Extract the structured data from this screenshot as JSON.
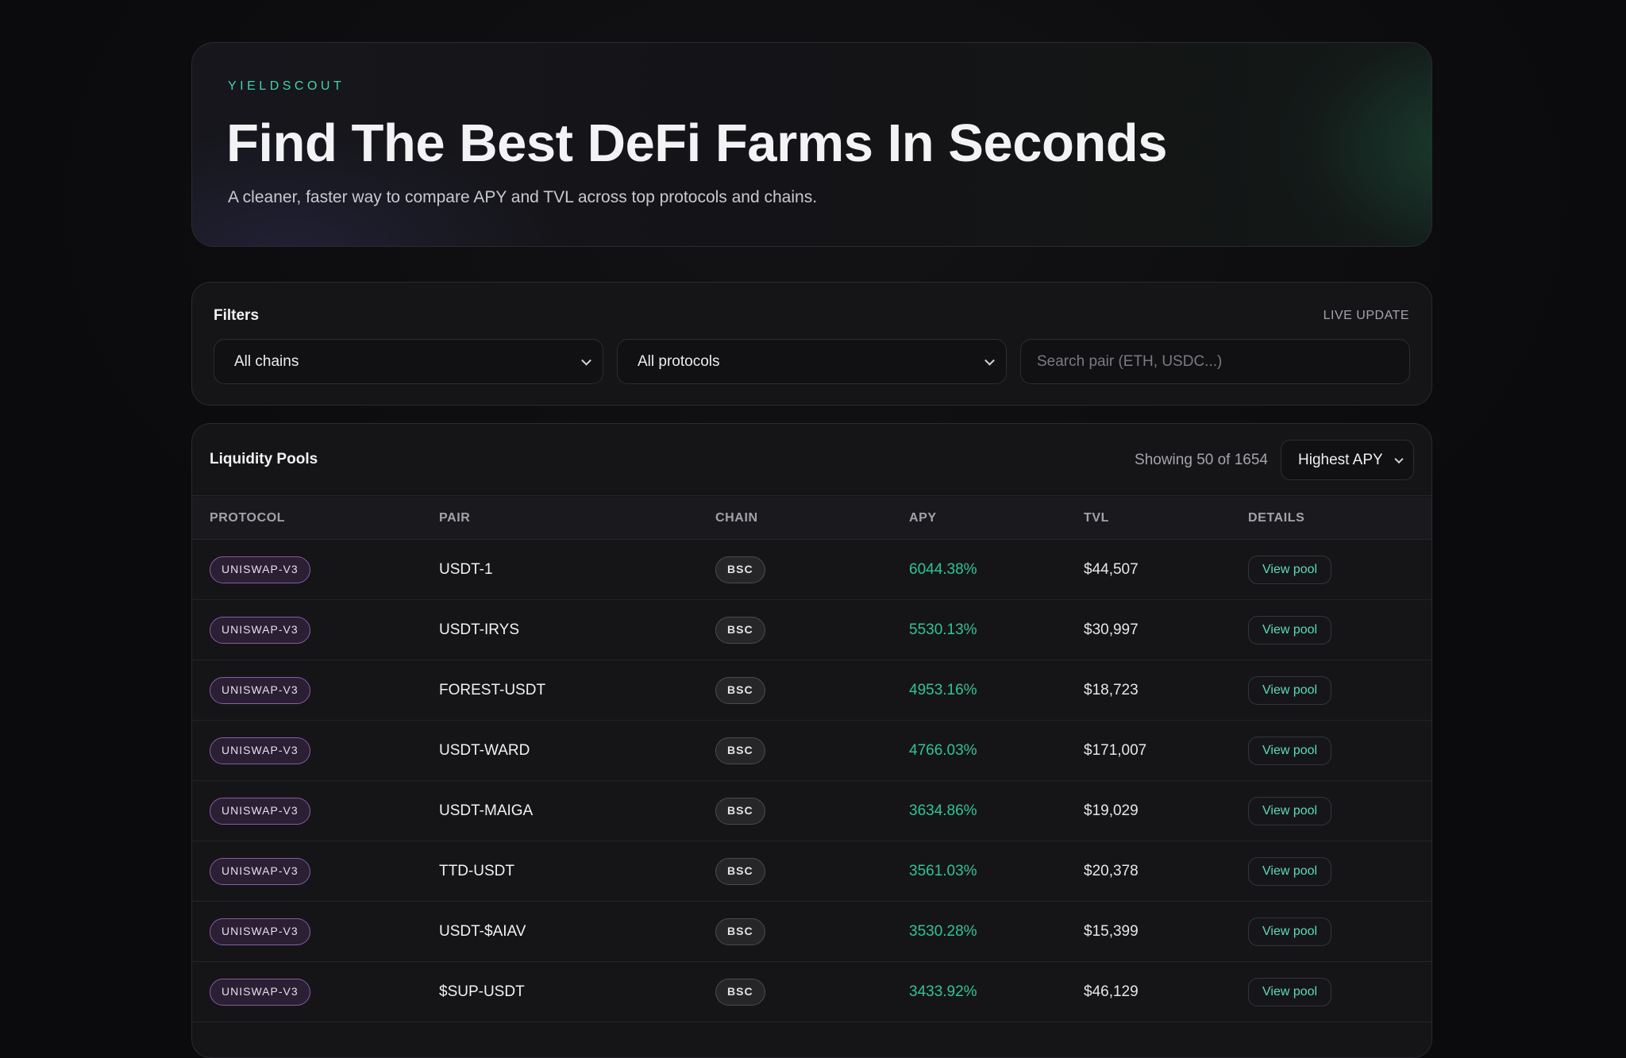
{
  "hero": {
    "brand": "YIELDSCOUT",
    "title": "Find The Best DeFi Farms In Seconds",
    "subtitle": "A cleaner, faster way to compare APY and TVL across top protocols and chains."
  },
  "filters": {
    "title": "Filters",
    "live_label": "LIVE UPDATE",
    "chain_select": "All chains",
    "protocol_select": "All protocols",
    "search_placeholder": "Search pair (ETH, USDC...)"
  },
  "pools": {
    "title": "Liquidity Pools",
    "showing": "Showing 50 of 1654",
    "sort": "Highest APY",
    "columns": [
      "PROTOCOL",
      "PAIR",
      "CHAIN",
      "APY",
      "TVL",
      "DETAILS"
    ],
    "rows": [
      {
        "protocol": "UNISWAP-V3",
        "pair": "USDT-1",
        "chain": "BSC",
        "apy": "6044.38%",
        "tvl": "$44,507",
        "details": "View pool"
      },
      {
        "protocol": "UNISWAP-V3",
        "pair": "USDT-IRYS",
        "chain": "BSC",
        "apy": "5530.13%",
        "tvl": "$30,997",
        "details": "View pool"
      },
      {
        "protocol": "UNISWAP-V3",
        "pair": "FOREST-USDT",
        "chain": "BSC",
        "apy": "4953.16%",
        "tvl": "$18,723",
        "details": "View pool"
      },
      {
        "protocol": "UNISWAP-V3",
        "pair": "USDT-WARD",
        "chain": "BSC",
        "apy": "4766.03%",
        "tvl": "$171,007",
        "details": "View pool"
      },
      {
        "protocol": "UNISWAP-V3",
        "pair": "USDT-MAIGA",
        "chain": "BSC",
        "apy": "3634.86%",
        "tvl": "$19,029",
        "details": "View pool"
      },
      {
        "protocol": "UNISWAP-V3",
        "pair": "TTD-USDT",
        "chain": "BSC",
        "apy": "3561.03%",
        "tvl": "$20,378",
        "details": "View pool"
      },
      {
        "protocol": "UNISWAP-V3",
        "pair": "USDT-$AIAV",
        "chain": "BSC",
        "apy": "3530.28%",
        "tvl": "$15,399",
        "details": "View pool"
      },
      {
        "protocol": "UNISWAP-V3",
        "pair": "$SUP-USDT",
        "chain": "BSC",
        "apy": "3433.92%",
        "tvl": "$46,129",
        "details": "View pool"
      }
    ]
  },
  "colors": {
    "accent": "#3fd4ae",
    "apy_green": "#32c48f",
    "protocol_badge_border": "#8a5aa6",
    "background": "#0b0b0d"
  }
}
